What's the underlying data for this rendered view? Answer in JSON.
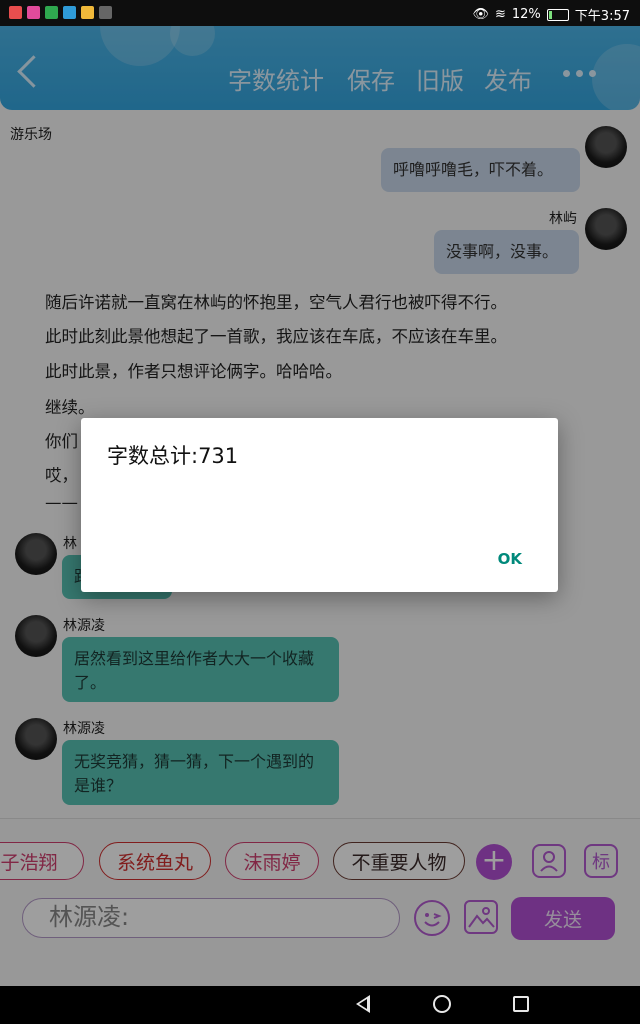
{
  "status_bar": {
    "battery": "12%",
    "time": "下午3:57",
    "battery_level": 0.12
  },
  "header": {
    "buttons": [
      "字数统计",
      "保存",
      "旧版",
      "发布"
    ]
  },
  "channel": "游乐场",
  "messages": {
    "top_right": "呼噜呼噜毛，吓不着。",
    "linyu_name": "林屿",
    "linyu_text": "没事啊，没事。",
    "narration": [
      "随后许诺就一直窝在林屿的怀抱里，空气人君行也被吓得不行。",
      "此时此刻此景他想起了一首歌，我应该在车底，不应该在车里。",
      "此时此景，作者只想评论俩字。哈哈哈。",
      "继续。",
      "你们",
      "哎，",
      "——"
    ],
    "partial_name": "林",
    "partial_text": "跟",
    "lin2_name": "林源凌",
    "lin2_text": "居然看到这里给作者大大一个收藏了。",
    "lin3_name": "林源凌",
    "lin3_text": "无奖竞猜，猜一猜，下一个遇到的是谁？"
  },
  "chips": [
    {
      "label": "子浩翔",
      "color": "#d04070"
    },
    {
      "label": "系统鱼丸",
      "color": "#d0302f"
    },
    {
      "label": "沫雨婷",
      "color": "#d04070"
    },
    {
      "label": "不重要人物",
      "color": "#6a3b32"
    }
  ],
  "bottom": {
    "plus": "+",
    "tag_label": "标",
    "input_value": "林源凌:",
    "send_label": "发送"
  },
  "dialog": {
    "title": "字数总计:731",
    "ok_label": "OK"
  }
}
